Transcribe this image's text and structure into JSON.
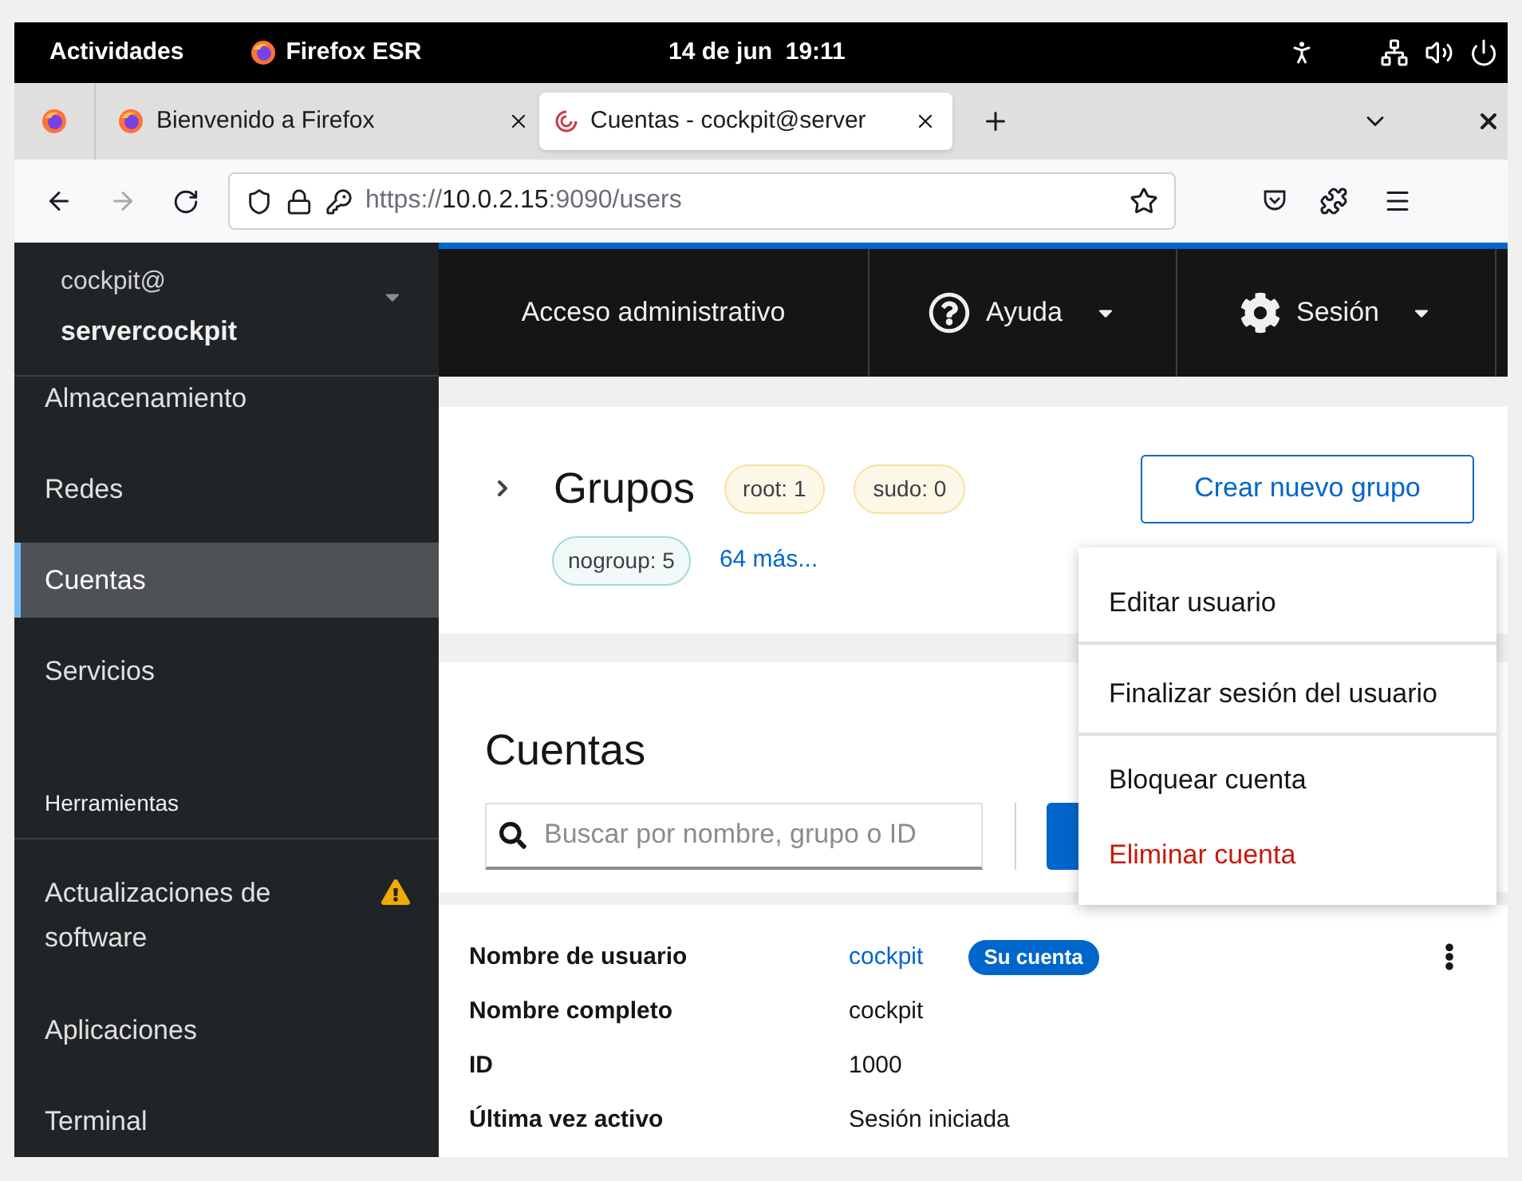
{
  "top_bar": {
    "activities": "Actividades",
    "app_name": "Firefox ESR",
    "clock": "14 de jun  19:11"
  },
  "tabs": [
    {
      "label": "Bienvenido a Firefox",
      "kind": "firefox",
      "selected": false
    },
    {
      "label": "Cuentas - cockpit@server",
      "kind": "cockpit",
      "selected": true
    }
  ],
  "url": {
    "scheme": "https://",
    "host": "10.0.2.15",
    "rest": ":9090/users"
  },
  "host": {
    "user": "cockpit@",
    "name": "servercockpit"
  },
  "sidebar": {
    "items": [
      {
        "label": "Almacenamiento",
        "kind": "item",
        "selected": false,
        "warning": false
      },
      {
        "label": "Redes",
        "kind": "item",
        "selected": false,
        "warning": false
      },
      {
        "label": "Cuentas",
        "kind": "item",
        "selected": true,
        "warning": false
      },
      {
        "label": "Servicios",
        "kind": "item",
        "selected": false,
        "warning": false
      },
      {
        "label": "Herramientas",
        "kind": "header",
        "selected": false,
        "warning": false
      },
      {
        "label": "Actualizaciones de software",
        "kind": "item",
        "selected": false,
        "warning": true
      },
      {
        "label": "Aplicaciones",
        "kind": "item",
        "selected": false,
        "warning": false
      },
      {
        "label": "Terminal",
        "kind": "item",
        "selected": false,
        "warning": false
      }
    ]
  },
  "topnav": {
    "admin": "Acceso administrativo",
    "help": "Ayuda",
    "session": "Sesión"
  },
  "groups": {
    "title": "Grupos",
    "badges": [
      {
        "label": "root: 1",
        "color": "#fdf7e7"
      },
      {
        "label": "sudo: 0",
        "color": "#fdf7e7"
      },
      {
        "label": "nogroup: 5",
        "color": "#f2f9f9"
      }
    ],
    "more": "64 más...",
    "create": "Crear nuevo grupo"
  },
  "accounts": {
    "title": "Cuentas",
    "search": {
      "placeholder": "Buscar por nombre, grupo o ID"
    }
  },
  "account": {
    "badge": "Su cuenta",
    "fields": [
      {
        "label": "Nombre de usuario",
        "value": "cockpit",
        "kind": "link"
      },
      {
        "label": "Nombre completo",
        "value": "cockpit",
        "kind": "text"
      },
      {
        "label": "ID",
        "value": "1000",
        "kind": "text"
      },
      {
        "label": "Última vez activo",
        "value": "Sesión iniciada",
        "kind": "text"
      }
    ]
  },
  "menu": {
    "items": [
      {
        "label": "Editar usuario",
        "kind": "normal",
        "divider_after": true
      },
      {
        "label": "Finalizar sesión del usuario",
        "kind": "normal",
        "divider_after": true
      },
      {
        "label": "Bloquear cuenta",
        "kind": "normal",
        "divider_after": false
      },
      {
        "label": "Eliminar cuenta",
        "kind": "danger",
        "divider_after": false
      }
    ]
  }
}
